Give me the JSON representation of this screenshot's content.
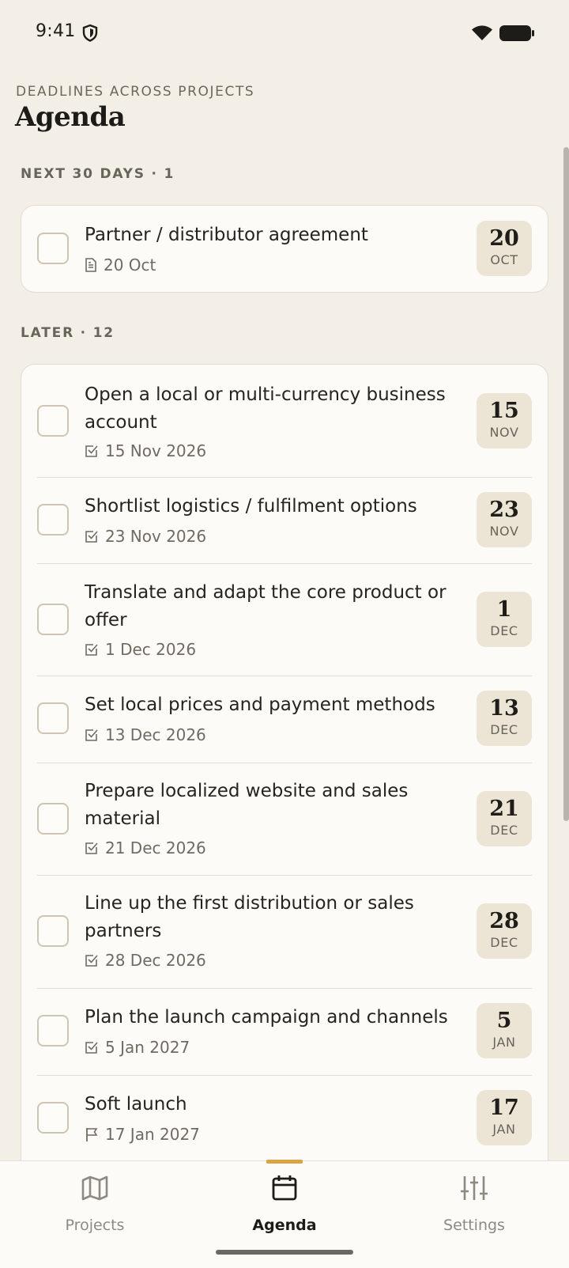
{
  "status_bar": {
    "time": "9:41"
  },
  "header": {
    "eyebrow": "DEADLINES ACROSS PROJECTS",
    "title": "Agenda"
  },
  "sections": [
    {
      "label": "NEXT 30 DAYS · 1",
      "items": [
        {
          "title": "Partner / distributor agreement",
          "meta": "20 Oct",
          "meta_icon": "document-icon",
          "day": "20",
          "month": "OCT"
        }
      ]
    },
    {
      "label": "LATER · 12",
      "items": [
        {
          "title": "Open a local or multi-currency business account",
          "meta": "15 Nov 2026",
          "meta_icon": "task-check-icon",
          "day": "15",
          "month": "NOV"
        },
        {
          "title": "Shortlist logistics / fulfilment options",
          "meta": "23 Nov 2026",
          "meta_icon": "task-check-icon",
          "day": "23",
          "month": "NOV"
        },
        {
          "title": "Translate and adapt the core product or offer",
          "meta": "1 Dec 2026",
          "meta_icon": "task-check-icon",
          "day": "1",
          "month": "DEC"
        },
        {
          "title": "Set local prices and payment methods",
          "meta": "13 Dec 2026",
          "meta_icon": "task-check-icon",
          "day": "13",
          "month": "DEC"
        },
        {
          "title": "Prepare localized website and sales material",
          "meta": "21 Dec 2026",
          "meta_icon": "task-check-icon",
          "day": "21",
          "month": "DEC"
        },
        {
          "title": "Line up the first distribution or sales partners",
          "meta": "28 Dec 2026",
          "meta_icon": "task-check-icon",
          "day": "28",
          "month": "DEC"
        },
        {
          "title": "Plan the launch campaign and channels",
          "meta": "5 Jan 2027",
          "meta_icon": "task-check-icon",
          "day": "5",
          "month": "JAN"
        },
        {
          "title": "Soft launch",
          "meta": "17 Jan 2027",
          "meta_icon": "flag-icon",
          "day": "17",
          "month": "JAN"
        }
      ]
    }
  ],
  "tab_bar": {
    "tabs": [
      {
        "label": "Projects",
        "icon": "map-icon",
        "active": false
      },
      {
        "label": "Agenda",
        "icon": "calendar-icon",
        "active": true
      },
      {
        "label": "Settings",
        "icon": "sliders-icon",
        "active": false
      }
    ]
  },
  "colors": {
    "background": "#f4efe6",
    "card": "#fcfbf7",
    "accent": "#d9a441",
    "badge": "#ece5d6"
  }
}
